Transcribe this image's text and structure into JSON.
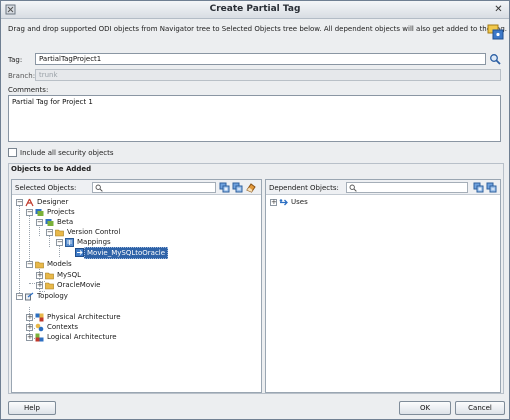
{
  "window": {
    "title": "Create Partial Tag"
  },
  "instructions": "Drag and drop supported ODI objects from Navigator tree to Selected Objects tree below. All dependent objects will also get added to the tag.",
  "form": {
    "tag_label": "Tag:",
    "tag_value": "PartialTagProject1",
    "branch_label": "Branch:",
    "branch_value": "trunk",
    "comments_label": "Comments:",
    "comments_value": "Partial Tag for Project 1",
    "include_security_label": "Include all security objects",
    "include_security_checked": false
  },
  "objects_section": {
    "title": "Objects to be Added",
    "selected_label": "Selected Objects:",
    "dependent_label": "Dependent Objects:"
  },
  "selected_tree": [
    {
      "label": "Designer",
      "icon": "designer-icon",
      "expander": "−"
    },
    {
      "label": "Projects",
      "icon": "projects-folder-icon",
      "expander": "−"
    },
    {
      "label": "Beta",
      "icon": "project-icon",
      "expander": "−"
    },
    {
      "label": "Version Control",
      "icon": "folder-icon",
      "expander": "−"
    },
    {
      "label": "Mappings",
      "icon": "mappings-icon",
      "expander": "−"
    },
    {
      "label": "Movie_MySQLtoOracle",
      "icon": "mapping-icon",
      "expander": "",
      "selected": true
    },
    {
      "label": "Models",
      "icon": "folder-icon",
      "expander": "−"
    },
    {
      "label": "MySQL",
      "icon": "folder-icon",
      "expander": "+"
    },
    {
      "label": "OracleMovie",
      "icon": "folder-icon",
      "expander": "+"
    },
    {
      "label": "Topology",
      "icon": "topology-icon",
      "expander": "−"
    },
    {
      "label": "Physical Architecture",
      "icon": "physical-architecture-icon",
      "expander": "+"
    },
    {
      "label": "Contexts",
      "icon": "contexts-icon",
      "expander": "+"
    },
    {
      "label": "Logical Architecture",
      "icon": "logical-architecture-icon",
      "expander": "+"
    }
  ],
  "dependent_tree": [
    {
      "label": "Uses",
      "icon": "uses-icon",
      "expander": "+"
    }
  ],
  "buttons": {
    "help": "Help",
    "ok": "OK",
    "cancel": "Cancel"
  },
  "colors": {
    "selection": "#2f63a8",
    "folder": "#e8b84a"
  }
}
